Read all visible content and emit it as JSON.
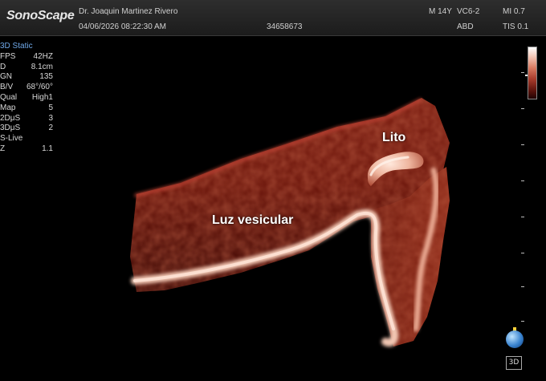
{
  "header": {
    "logo": "SonoScape",
    "physician": "Dr. Joaquin Martinez Rivero",
    "datetime": "04/06/2026 08:22:30 AM",
    "patient_id": "34658673",
    "patient_info": "M 14Y",
    "probe": "VC6-2",
    "preset": "ABD",
    "mi": "MI 0.7",
    "tis": "TIS 0.1"
  },
  "params": {
    "mode": "3D Static",
    "rows": [
      {
        "key": "FPS",
        "value": "42HZ"
      },
      {
        "key": "D",
        "value": "8.1cm"
      },
      {
        "key": "GN",
        "value": "135"
      },
      {
        "key": "B/V",
        "value": "68°/60°"
      },
      {
        "key": "Qual",
        "value": "High1"
      },
      {
        "key": "Map",
        "value": "5"
      },
      {
        "key": "2DμS",
        "value": "3"
      },
      {
        "key": "3DμS",
        "value": "2"
      },
      {
        "key": "S-Live",
        "value": ""
      },
      {
        "key": "Z",
        "value": "1.1"
      }
    ]
  },
  "annotations": {
    "lumen": "Luz vesicular",
    "stone": "Lito"
  },
  "controls": {
    "view_3d": "3D"
  },
  "colors": {
    "tissue_dark": "#3a0804",
    "tissue_mid": "#8a2416",
    "tissue_bright": "#f1c6b2",
    "mode_text": "#6fa8e8"
  }
}
